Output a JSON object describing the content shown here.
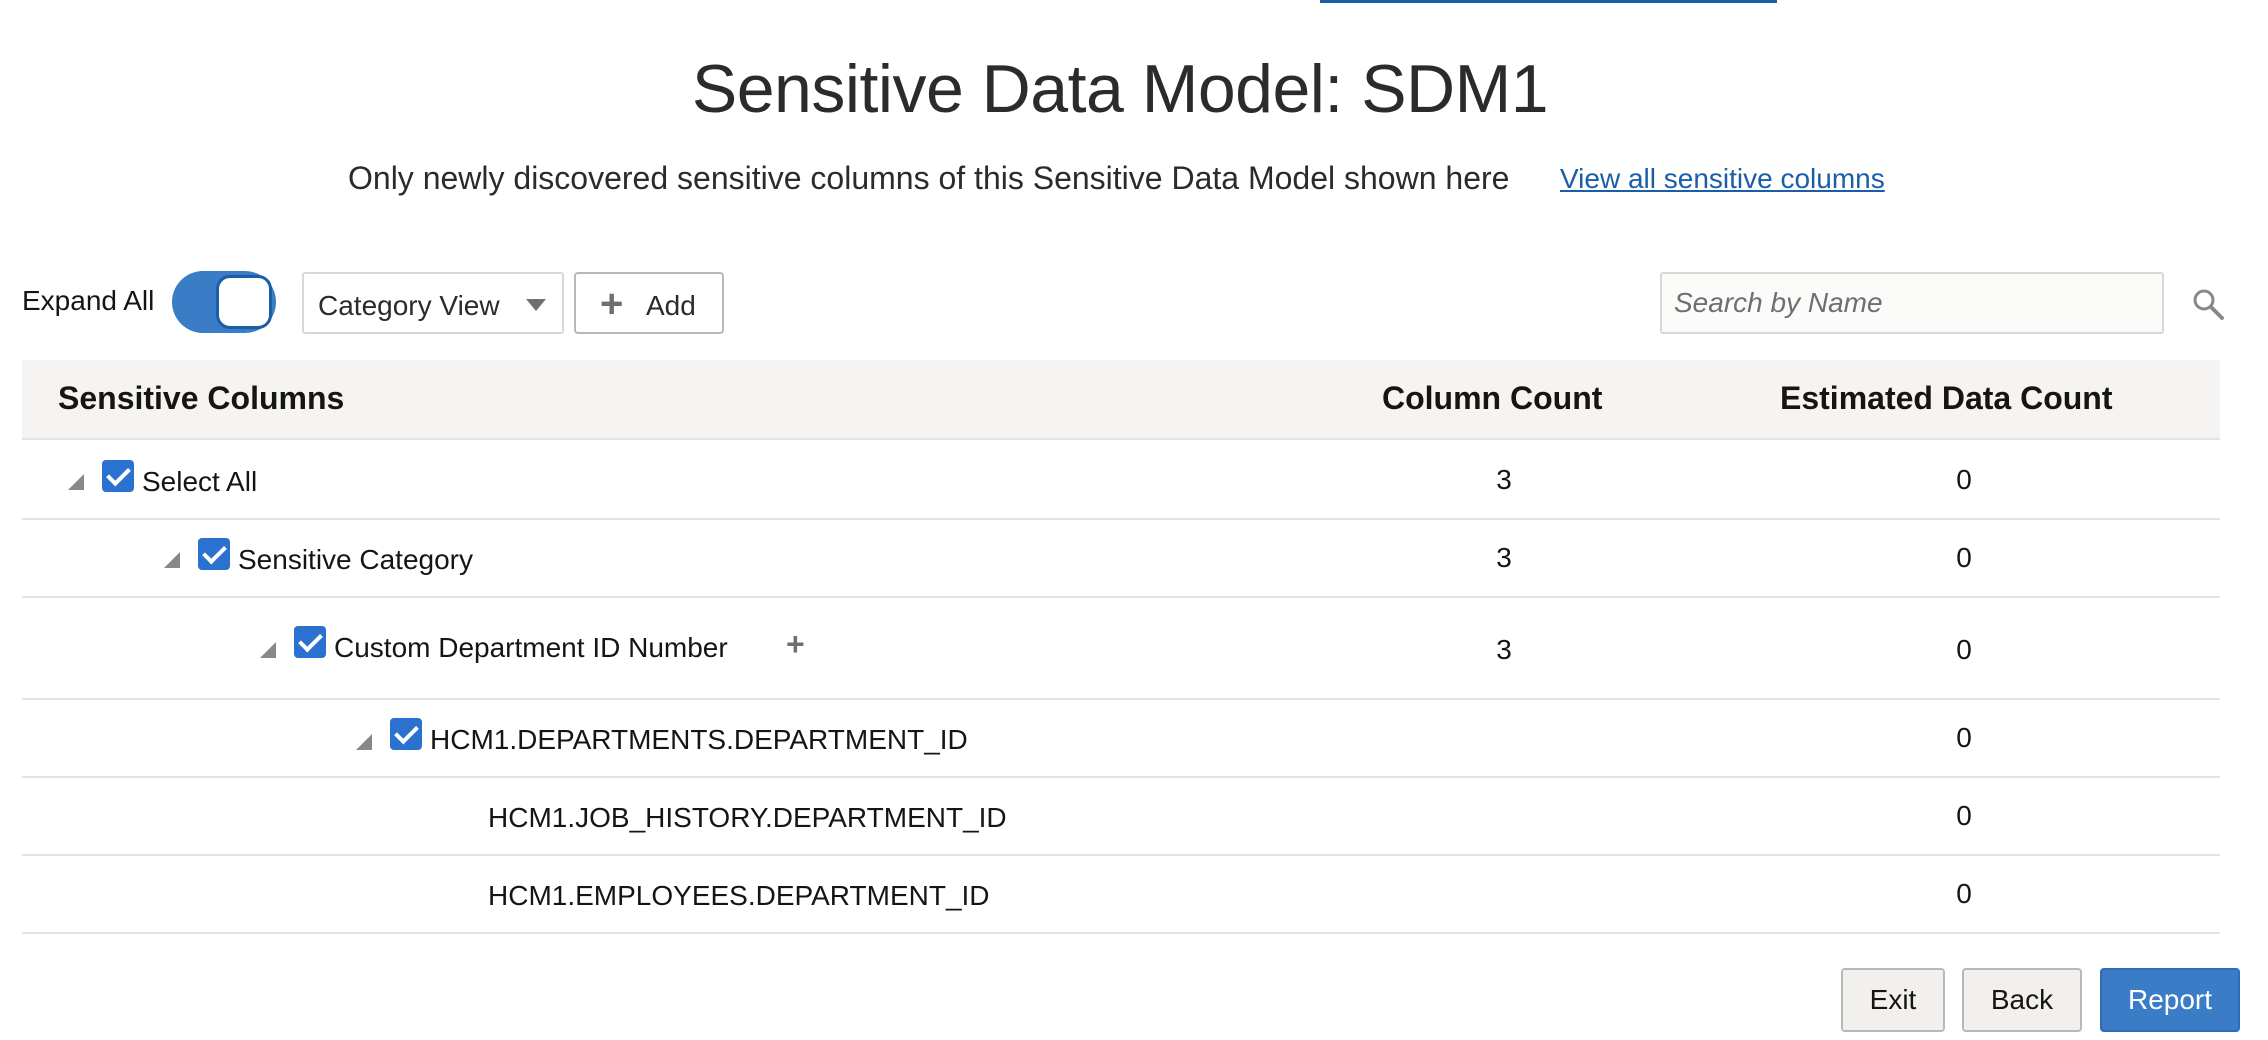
{
  "page": {
    "title": "Sensitive Data Model: SDM1",
    "subtitle": "Only newly discovered sensitive columns of this Sensitive Data Model shown here",
    "view_all_link": "View all sensitive columns"
  },
  "toolbar": {
    "expand_all_label": "Expand All",
    "expand_all_on": true,
    "view_select_value": "Category View",
    "add_label": "Add",
    "search_placeholder": "Search by Name"
  },
  "table": {
    "headers": {
      "name": "Sensitive Columns",
      "column_count": "Column Count",
      "estimated_data_count": "Estimated Data Count"
    },
    "rows": [
      {
        "label": "Select All",
        "column_count": "3",
        "estimated_data_count": "0",
        "expanded": true,
        "checked": true
      },
      {
        "label": "Sensitive Category",
        "column_count": "3",
        "estimated_data_count": "0",
        "expanded": true,
        "checked": true
      },
      {
        "label": "Custom Department ID Number",
        "column_count": "3",
        "estimated_data_count": "0",
        "expanded": true,
        "checked": true
      },
      {
        "label": "HCM1.DEPARTMENTS.DEPARTMENT_ID",
        "column_count": "",
        "estimated_data_count": "0",
        "expanded": true,
        "checked": true
      },
      {
        "label": "HCM1.JOB_HISTORY.DEPARTMENT_ID",
        "column_count": "",
        "estimated_data_count": "0"
      },
      {
        "label": "HCM1.EMPLOYEES.DEPARTMENT_ID",
        "column_count": "",
        "estimated_data_count": "0"
      }
    ]
  },
  "footer": {
    "exit_label": "Exit",
    "back_label": "Back",
    "report_label": "Report"
  },
  "colors": {
    "accent": "#3a7cc6",
    "link": "#1b5ea8",
    "checkbox": "#2a71d0"
  }
}
